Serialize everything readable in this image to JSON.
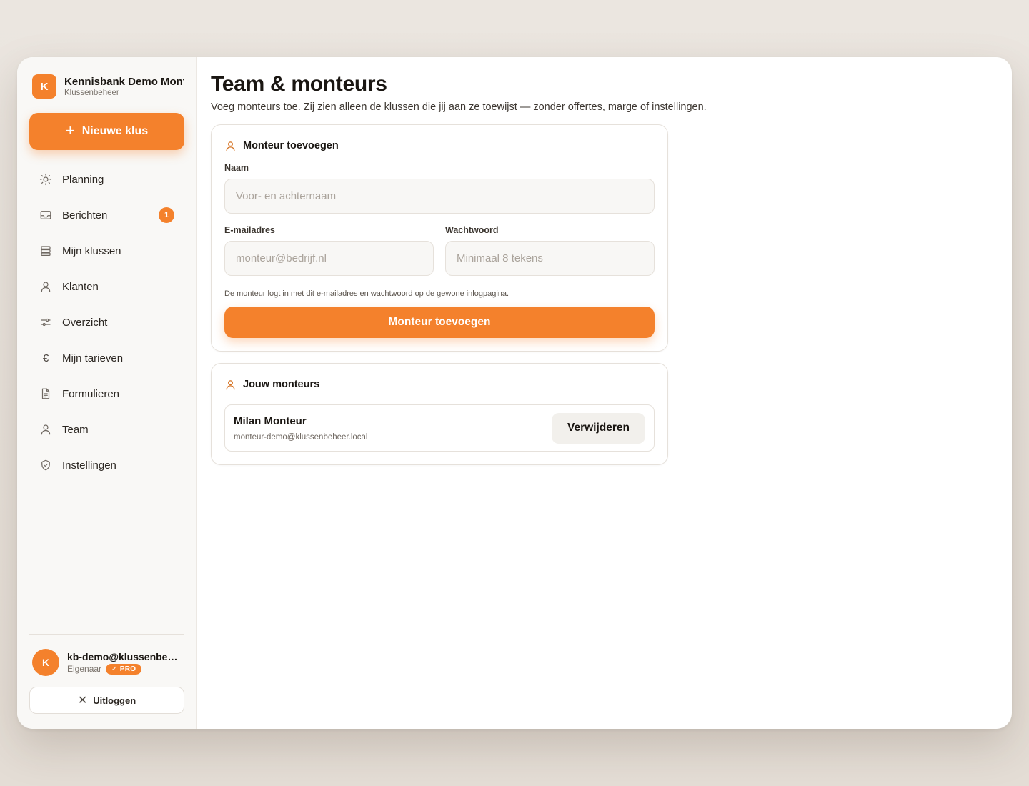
{
  "brand": {
    "logo_letter": "K",
    "name": "Kennisbank Demo Montage",
    "subtitle": "Klussenbeheer"
  },
  "sidebar": {
    "new_button": {
      "icon": "plus-icon",
      "label": "Nieuwe klus"
    },
    "items": [
      {
        "icon": "sun-icon",
        "label": "Planning"
      },
      {
        "icon": "inbox-icon",
        "label": "Berichten",
        "badge": "1"
      },
      {
        "icon": "stack-icon",
        "label": "Mijn klussen"
      },
      {
        "icon": "user-icon",
        "label": "Klanten"
      },
      {
        "icon": "sliders-icon",
        "label": "Overzicht"
      },
      {
        "icon": "euro-icon",
        "label": "Mijn tarieven"
      },
      {
        "icon": "document-icon",
        "label": "Formulieren"
      },
      {
        "icon": "user-icon",
        "label": "Team"
      },
      {
        "icon": "shield-check-icon",
        "label": "Instellingen"
      }
    ]
  },
  "user": {
    "avatar_letter": "K",
    "email": "kb-demo@klussenbeheer.local",
    "role": "Eigenaar",
    "plan_badge": "PRO",
    "plan_icon": "check-icon"
  },
  "logout": {
    "icon": "close-icon",
    "label": "Uitloggen"
  },
  "page": {
    "title": "Team & monteurs",
    "subtitle": "Voeg monteurs toe. Zij zien alleen de klussen die jij aan ze toewijst — zonder offertes, marge of instellingen."
  },
  "add_form": {
    "icon": "user-icon",
    "title": "Monteur toevoegen",
    "name_label": "Naam",
    "name_placeholder": "Voor- en achternaam",
    "email_label": "E-mailadres",
    "email_placeholder": "monteur@bedrijf.nl",
    "password_label": "Wachtwoord",
    "password_placeholder": "Minimaal 8 tekens",
    "hint": "De monteur logt in met dit e-mailadres en wachtwoord op de gewone inlogpagina.",
    "submit_label": "Monteur toevoegen"
  },
  "members": {
    "icon": "user-icon",
    "title": "Jouw monteurs",
    "list": [
      {
        "name": "Milan Monteur",
        "email": "monteur-demo@klussenbeheer.local",
        "remove_label": "Verwijderen"
      }
    ]
  },
  "colors": {
    "accent": "#f4812c",
    "accent_icon": "#d4701f",
    "sidebar_bg": "#f9f8f6",
    "page_bg": "#e8e2db"
  }
}
